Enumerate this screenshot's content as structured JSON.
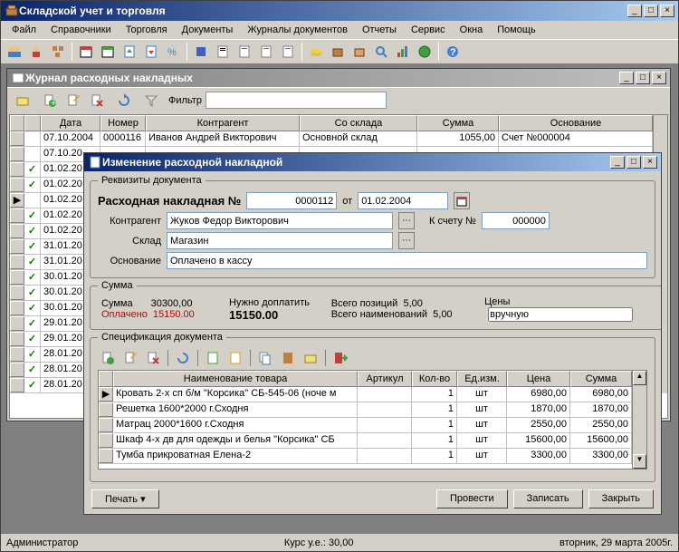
{
  "window": {
    "title": "Складской учет и торговля"
  },
  "menu": [
    "Файл",
    "Справочники",
    "Торговля",
    "Документы",
    "Журналы документов",
    "Отчеты",
    "Сервис",
    "Окна",
    "Помощь"
  ],
  "journal": {
    "title": "Журнал расходных накладных",
    "filter_label": "Фильтр",
    "columns": {
      "date": "Дата",
      "number": "Номер",
      "counterparty": "Контрагент",
      "from_warehouse": "Со склада",
      "sum": "Сумма",
      "basis": "Основание"
    },
    "rows": [
      {
        "check": "",
        "date": "07.10.2004",
        "number": "0000116",
        "counterparty": "Иванов Андрей Викторович",
        "from_warehouse": "Основной склад",
        "sum": "1055,00",
        "basis": "Счет №000004"
      },
      {
        "check": "",
        "date": "07.10.20"
      },
      {
        "check": "✓",
        "date": "01.02.20"
      },
      {
        "check": "✓",
        "date": "01.02.20"
      },
      {
        "check": "",
        "date": "01.02.20",
        "indicator": "▶"
      },
      {
        "check": "✓",
        "date": "01.02.20"
      },
      {
        "check": "✓",
        "date": "01.02.20"
      },
      {
        "check": "✓",
        "date": "31.01.20"
      },
      {
        "check": "✓",
        "date": "31.01.20"
      },
      {
        "check": "✓",
        "date": "30.01.20"
      },
      {
        "check": "✓",
        "date": "30.01.20"
      },
      {
        "check": "✓",
        "date": "30.01.20"
      },
      {
        "check": "✓",
        "date": "29.01.20"
      },
      {
        "check": "✓",
        "date": "29.01.20"
      },
      {
        "check": "✓",
        "date": "28.01.20"
      },
      {
        "check": "✓",
        "date": "28.01.20"
      },
      {
        "check": "✓",
        "date": "28.01.20"
      }
    ]
  },
  "edit": {
    "title": "Изменение расходной накладной",
    "legend_req": "Реквизиты документа",
    "doc_label": "Расходная накладная №",
    "doc_number": "0000112",
    "from_label": "от",
    "doc_date": "01.02.2004",
    "counterparty_label": "Контрагент",
    "counterparty": "Жуков Федор Викторович",
    "to_account_label": "К счету №",
    "to_account": "000000",
    "warehouse_label": "Склад",
    "warehouse": "Магазин",
    "basis_label": "Основание",
    "basis": "Оплачено в кассу",
    "legend_sum": "Сумма",
    "sum_label": "Сумма",
    "sum": "30300,00",
    "paid_label": "Оплачено",
    "paid": "15150.00",
    "need_pay_label": "Нужно доплатить",
    "need_pay": "15150.00",
    "total_pos_label": "Всего позиций",
    "total_pos": "5,00",
    "total_names_label": "Всего наименований",
    "total_names": "5,00",
    "prices_label": "Цены",
    "prices_value": "вручную",
    "legend_spec": "Спецификация документа",
    "spec_columns": {
      "name": "Наименование товара",
      "article": "Артикул",
      "qty": "Кол-во",
      "unit": "Ед.изм.",
      "price": "Цена",
      "sum": "Сумма"
    },
    "spec_rows": [
      {
        "indicator": "▶",
        "name": "Кровать 2-х сп б/м \"Корсика\" СБ-545-06 (ноче м",
        "article": "",
        "qty": "1",
        "unit": "шт",
        "price": "6980,00",
        "sum": "6980,00"
      },
      {
        "name": "Решетка 1600*2000 г.Сходня",
        "article": "",
        "qty": "1",
        "unit": "шт",
        "price": "1870,00",
        "sum": "1870,00"
      },
      {
        "name": "Матрац 2000*1600 г.Сходня",
        "article": "",
        "qty": "1",
        "unit": "шт",
        "price": "2550,00",
        "sum": "2550,00"
      },
      {
        "name": "Шкаф 4-х дв  для одежды и белья \"Корсика\" СБ",
        "article": "",
        "qty": "1",
        "unit": "шт",
        "price": "15600,00",
        "sum": "15600,00"
      },
      {
        "name": "Тумба прикроватная Елена-2",
        "article": "",
        "qty": "1",
        "unit": "шт",
        "price": "3300,00",
        "sum": "3300,00"
      }
    ],
    "buttons": {
      "print": "Печать",
      "post": "Провести",
      "save": "Записать",
      "close": "Закрыть"
    }
  },
  "status": {
    "user": "Администратор",
    "rate": "Курс у.е.: 30,00",
    "date": "вторник, 29 марта 2005г."
  }
}
